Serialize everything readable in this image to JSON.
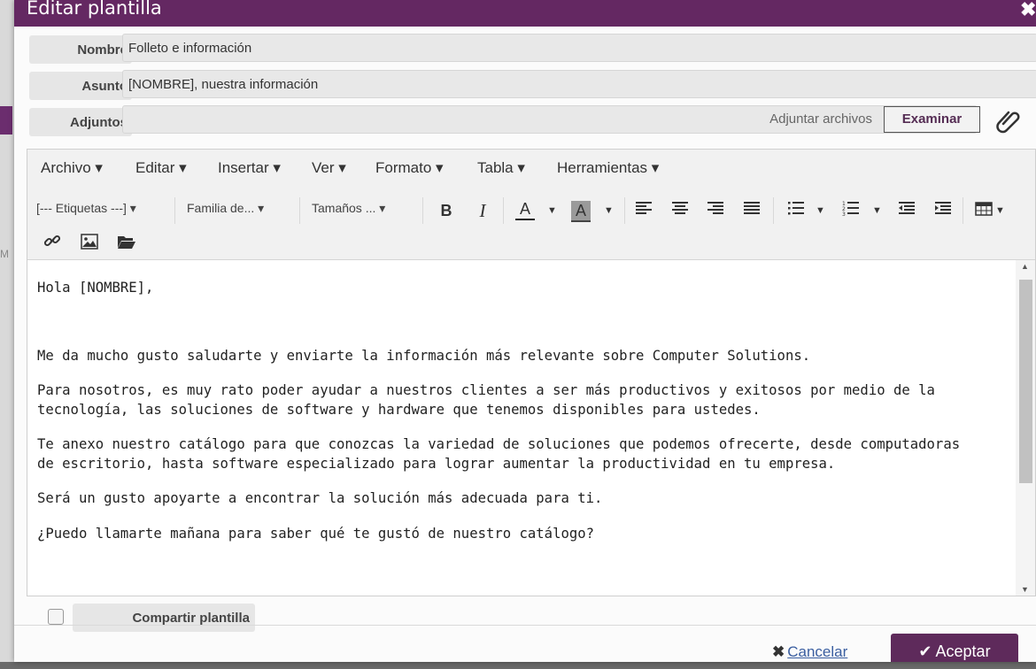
{
  "dialog": {
    "title": "Editar plantilla",
    "close_glyph": "✖"
  },
  "form": {
    "name_label": "Nombre",
    "name_value": "Folleto e información",
    "subject_label": "Asunto",
    "subject_value": "[NOMBRE], nuestra información",
    "attachments_label": "Adjuntos",
    "attach_hint": "Adjuntar archivos",
    "browse_label": "Examinar",
    "attach_icon": "paperclip-icon"
  },
  "menubar": [
    "Archivo",
    "Editar",
    "Insertar",
    "Ver",
    "Formato",
    "Tabla",
    "Herramientas"
  ],
  "toolbar": {
    "tags_select": "[--- Etiquetas ---]",
    "font_family_select": "Familia de...",
    "font_size_select": "Tamaños ...",
    "bold": "B",
    "italic": "I",
    "text_color": "A",
    "bg_color": "A",
    "icons": [
      "bold-icon",
      "italic-icon",
      "text-color-icon",
      "highlight-color-icon",
      "align-left-icon",
      "align-center-icon",
      "align-right-icon",
      "align-justify-icon",
      "bullet-list-icon",
      "numbered-list-icon",
      "outdent-icon",
      "indent-icon",
      "table-icon",
      "link-icon",
      "image-icon",
      "folder-open-icon"
    ]
  },
  "body": {
    "greeting": "Hola [NOMBRE],",
    "p1": "Me da mucho gusto saludarte y enviarte la información más relevante sobre Computer Solutions.",
    "p2": "Para nosotros, es muy rato poder ayudar a nuestros clientes a ser más productivos y exitosos por medio de la\ntecnología, las soluciones de software y hardware que tenemos disponibles para ustedes.",
    "p3": "Te anexo nuestro catálogo para que conozcas la variedad de soluciones que podemos ofrecerte, desde computadoras\nde escritorio, hasta software especializado para lograr aumentar la productividad en tu empresa.",
    "p4": "Será un gusto apoyarte a encontrar la solución más adecuada para ti.",
    "p5": "¿Puedo llamarte mañana para saber qué te gustó de nuestro catálogo?"
  },
  "footer": {
    "share_label": "Compartir plantilla",
    "cancel_label": "Cancelar",
    "accept_label": "Aceptar"
  },
  "colors": {
    "header": "#642862",
    "accept": "#5e2a5b",
    "link": "#3a5ea0"
  }
}
